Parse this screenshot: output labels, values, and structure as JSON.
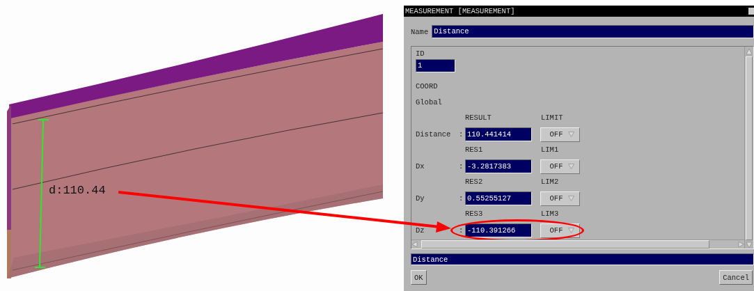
{
  "viewport": {
    "measurement_label": "d:110.44"
  },
  "dialog": {
    "title": "MEASUREMENT [MEASUREMENT]",
    "name_label": "Name",
    "name_value": "Distance",
    "id_label": "ID",
    "id_value": "1",
    "coord_label": "COORD",
    "coord_value": "Global",
    "rows": [
      {
        "result_header": "RESULT",
        "limit_header": "LIMIT",
        "label": "Distance",
        "separator": ":",
        "value": "110.441414",
        "limit": "OFF",
        "circled": false
      },
      {
        "result_header": "RES1",
        "limit_header": "LIM1",
        "label": "Dx",
        "separator": ":",
        "value": "-3.2817383",
        "limit": "OFF",
        "circled": false
      },
      {
        "result_header": "RES2",
        "limit_header": "LIM2",
        "label": "Dy",
        "separator": ":",
        "value": "0.55255127",
        "limit": "OFF",
        "circled": false
      },
      {
        "result_header": "RES3",
        "limit_header": "LIM3",
        "label": "Dz",
        "separator": ":",
        "value": "-110.391266",
        "limit": "OFF",
        "circled": true
      }
    ],
    "status": "Distance",
    "buttons": [
      "OK",
      "Cancel"
    ]
  }
}
